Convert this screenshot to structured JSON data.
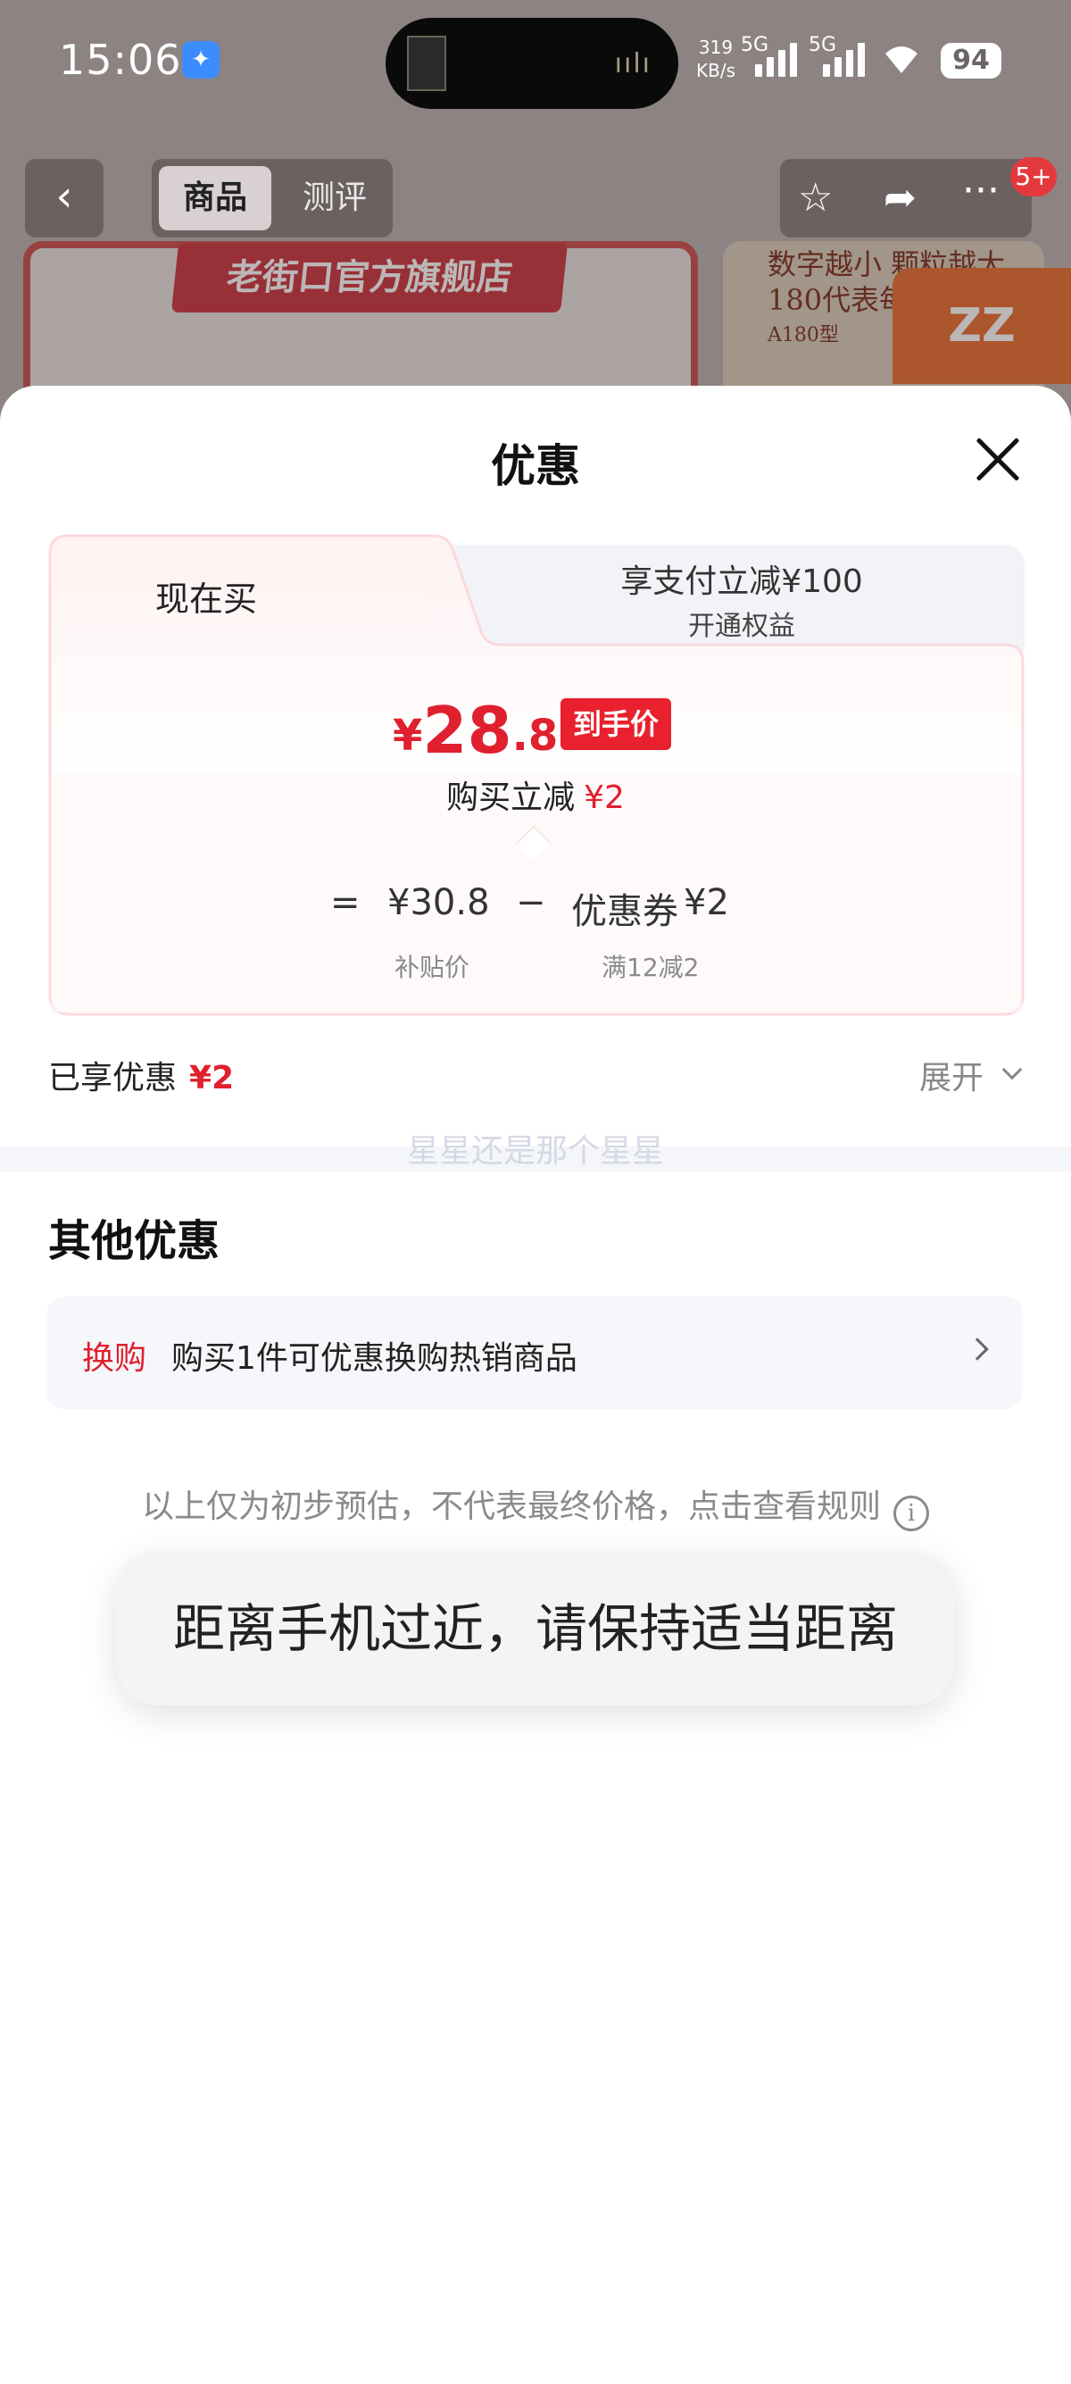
{
  "status_bar": {
    "time": "15:06",
    "net_speed_value": "319",
    "net_speed_unit": "KB/s",
    "net1": "5G",
    "net2": "5G",
    "wifi_sub": "6",
    "battery": "94",
    "island_music_art": "兵马俑"
  },
  "page_nav": {
    "tab_goods": "商品",
    "tab_review": "测评",
    "cart_count": "5+"
  },
  "background": {
    "shop_banner": "老街口官方旗舰店",
    "promo_text_1": "数字越小 颗粒越大",
    "promo_text_2": "180代表每磅",
    "promo_text_3": "A180型"
  },
  "sheet": {
    "title": "优惠",
    "tab_now": "现在买",
    "tab_pay_title": "享支付立减¥100",
    "tab_pay_sub": "开通权益",
    "final_price": {
      "currency": "¥",
      "integer": "28",
      "decimal": ".8",
      "tag": "到手价"
    },
    "reduce_label": "购买立减",
    "reduce_value": "¥2",
    "formula": {
      "equals": "=",
      "subsidy_price": "¥30.8",
      "minus": "−",
      "coupon_label": "优惠券",
      "coupon_value": "¥2",
      "subsidy_caption": "补贴价",
      "coupon_caption": "满12减2"
    },
    "enjoyed_label": "已享优惠",
    "enjoyed_value": "¥2",
    "expand_label": "展开",
    "watermark": "星星还是那个星星",
    "other_title": "其他优惠",
    "swap_tag": "换购",
    "swap_text": "购买1件可优惠换购热销商品",
    "disclaimer": "以上仅为初步预估，不代表最终价格，点击查看规则",
    "info_icon": "i"
  },
  "toast": {
    "message": "距离手机过近，请保持适当距离"
  },
  "colors": {
    "accent_red": "#e0202e",
    "tab_inactive_bg": "#f2f3f7",
    "box_border": "#fbd9dd"
  }
}
